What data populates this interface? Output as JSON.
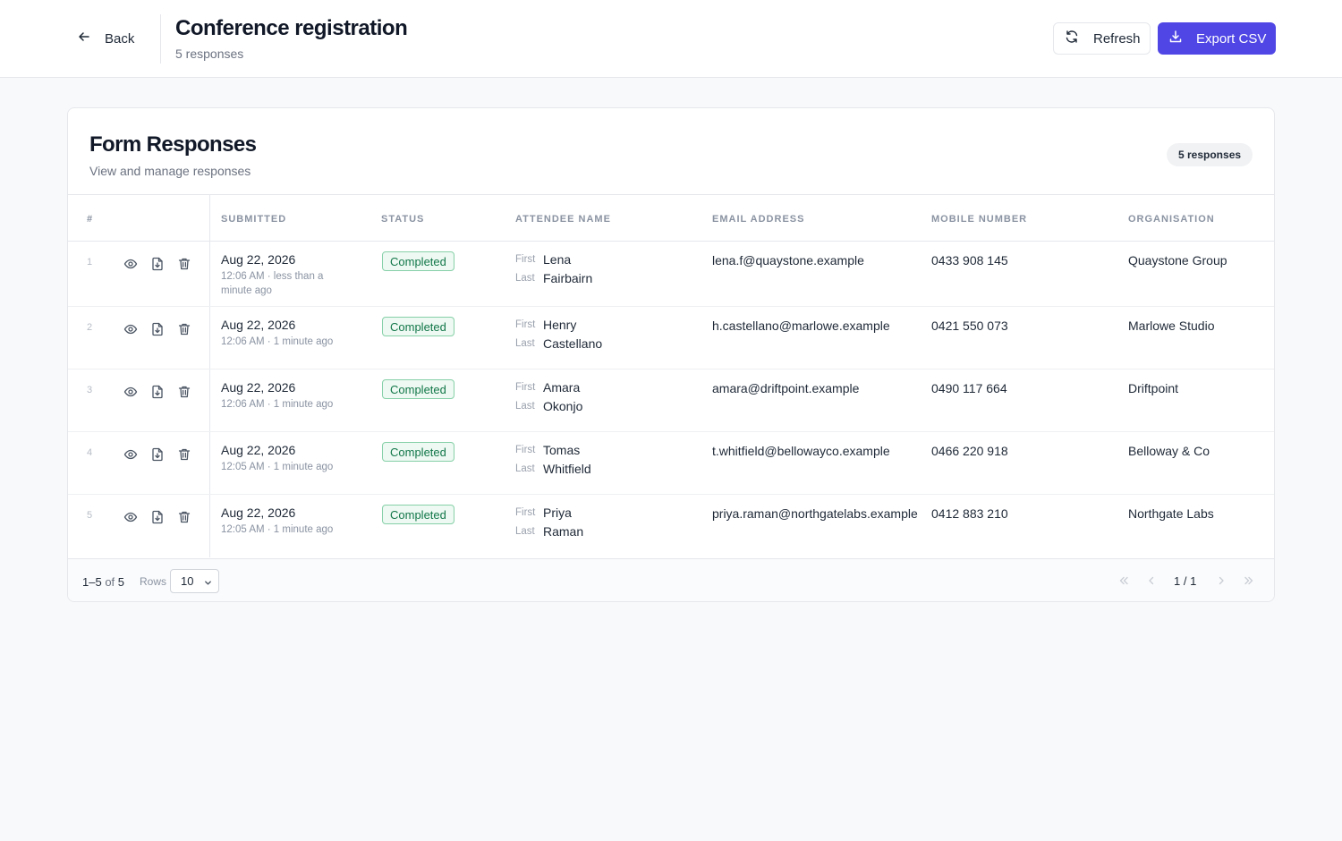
{
  "header": {
    "back_label": "Back",
    "title": "Conference registration",
    "subtitle": "5 responses",
    "refresh_label": "Refresh",
    "export_label": "Export CSV",
    "accent_color": "#4f46e5"
  },
  "card": {
    "title": "Form Responses",
    "subtitle": "View and manage responses",
    "count_badge": "5 responses"
  },
  "table": {
    "columns": [
      "#",
      "Submitted",
      "Status",
      "Attendee Name",
      "Email Address",
      "Mobile Number",
      "Organisation"
    ],
    "first_label": "First",
    "last_label": "Last",
    "row_actions": [
      "eye-icon",
      "download-file-icon",
      "trash-icon"
    ],
    "rows": [
      {
        "num": "1",
        "date": "Aug 22, 2026",
        "time": "12:06 AM · less than a minute ago",
        "status": "Completed",
        "first": "Lena",
        "last": "Fairbairn",
        "email": "lena.f@quaystone.example",
        "mobile": "0433 908 145",
        "org": "Quaystone Group"
      },
      {
        "num": "2",
        "date": "Aug 22, 2026",
        "time": "12:06 AM · 1 minute ago",
        "status": "Completed",
        "first": "Henry",
        "last": "Castellano",
        "email": "h.castellano@marlowe.example",
        "mobile": "0421 550 073",
        "org": "Marlowe Studio"
      },
      {
        "num": "3",
        "date": "Aug 22, 2026",
        "time": "12:06 AM · 1 minute ago",
        "status": "Completed",
        "first": "Amara",
        "last": "Okonjo",
        "email": "amara@driftpoint.example",
        "mobile": "0490 117 664",
        "org": "Driftpoint"
      },
      {
        "num": "4",
        "date": "Aug 22, 2026",
        "time": "12:05 AM · 1 minute ago",
        "status": "Completed",
        "first": "Tomas",
        "last": "Whitfield",
        "email": "t.whitfield@bellowayco.example",
        "mobile": "0466 220 918",
        "org": "Belloway & Co"
      },
      {
        "num": "5",
        "date": "Aug 22, 2026",
        "time": "12:05 AM · 1 minute ago",
        "status": "Completed",
        "first": "Priya",
        "last": "Raman",
        "email": "priya.raman@northgatelabs.example",
        "mobile": "0412 883 210",
        "org": "Northgate Labs"
      }
    ]
  },
  "footer": {
    "range": "1–5",
    "of_label": "of",
    "total": "5",
    "rows_label": "Rows",
    "rows_value": "10",
    "page_label": "1 / 1"
  }
}
